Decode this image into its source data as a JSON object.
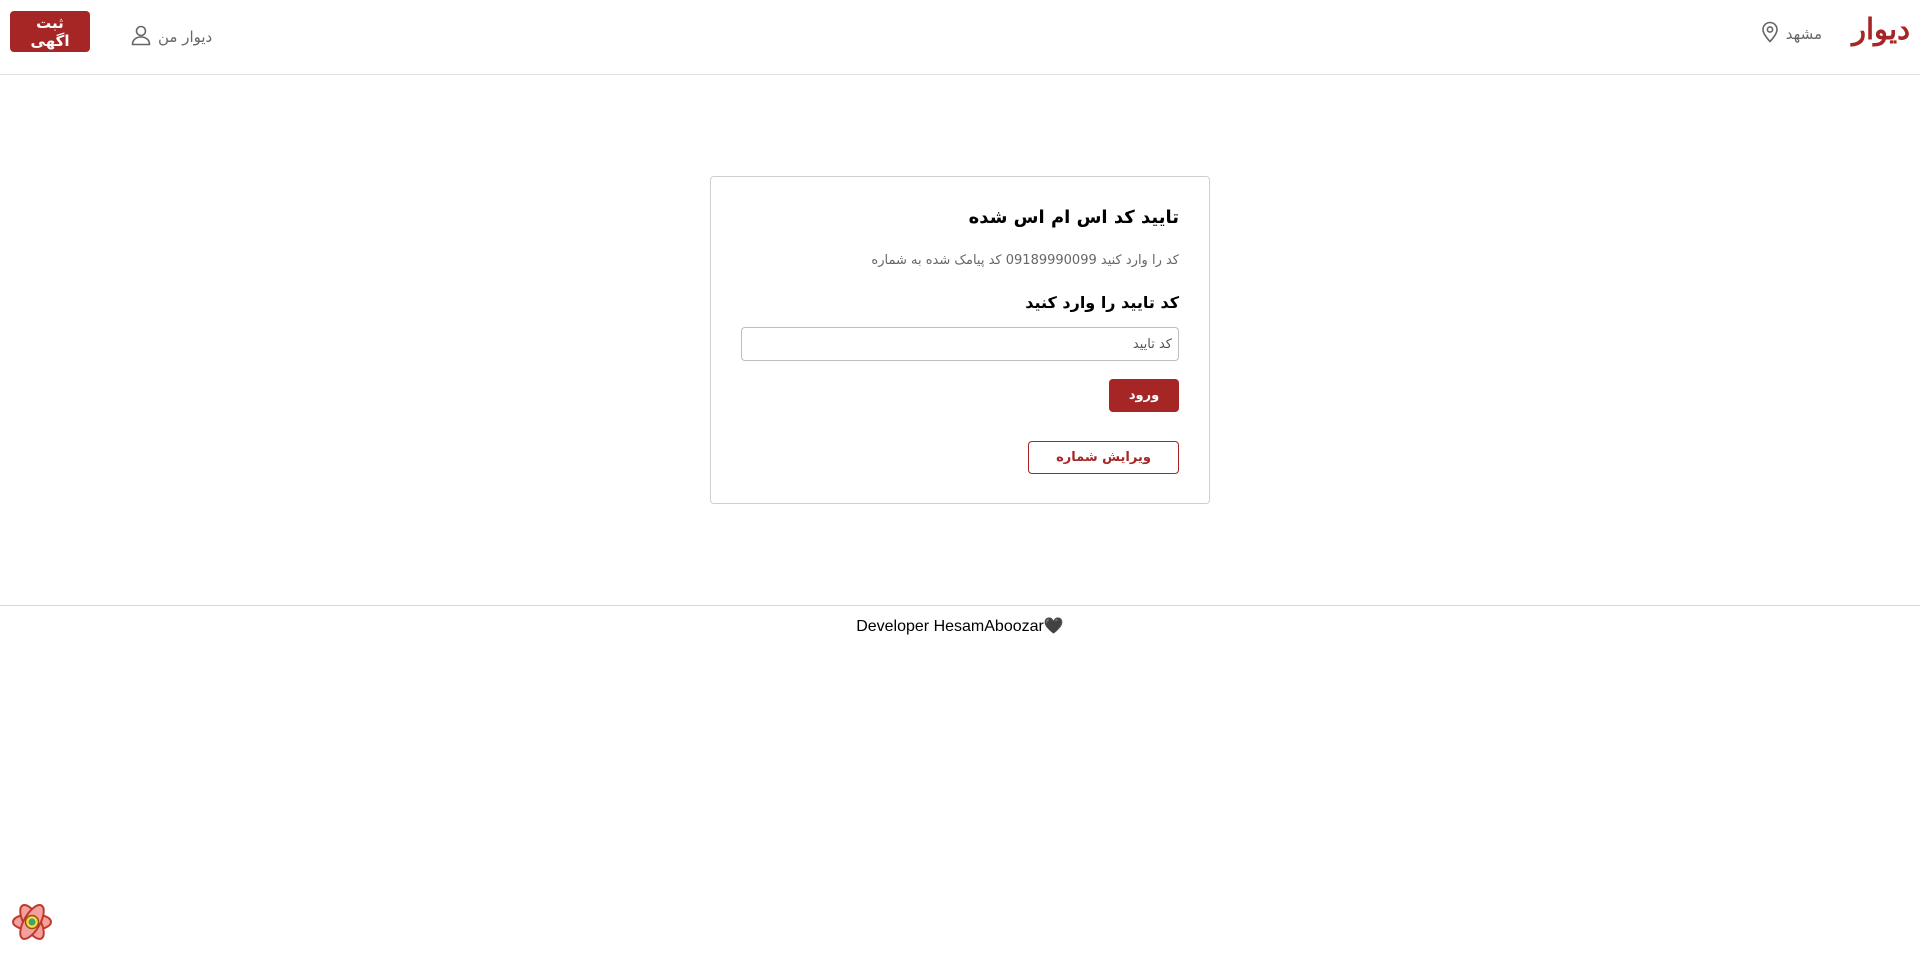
{
  "header": {
    "logo": "دیوار",
    "city": "مشهد",
    "my_divar": "دیوار من",
    "post_ad": "ثبت اگهی"
  },
  "verify": {
    "title": "تایید کد اس ام اس شده",
    "description": "کد را وارد کنید 09189990099 کد پیامک شده به شماره",
    "label": "کد تایید را وارد کنید",
    "input_placeholder": "کد تایید",
    "input_value": "",
    "login_button": "ورود",
    "edit_number_button": "ویرایش شماره"
  },
  "footer": {
    "text": "Developer HesamAboozar🖤"
  },
  "colors": {
    "brand": "#a62626",
    "muted_text": "#666666",
    "border": "#cfcfcf"
  },
  "icons": {
    "city": "location-pin-icon",
    "account": "user-icon",
    "devtools": "react-query-devtools-icon"
  }
}
